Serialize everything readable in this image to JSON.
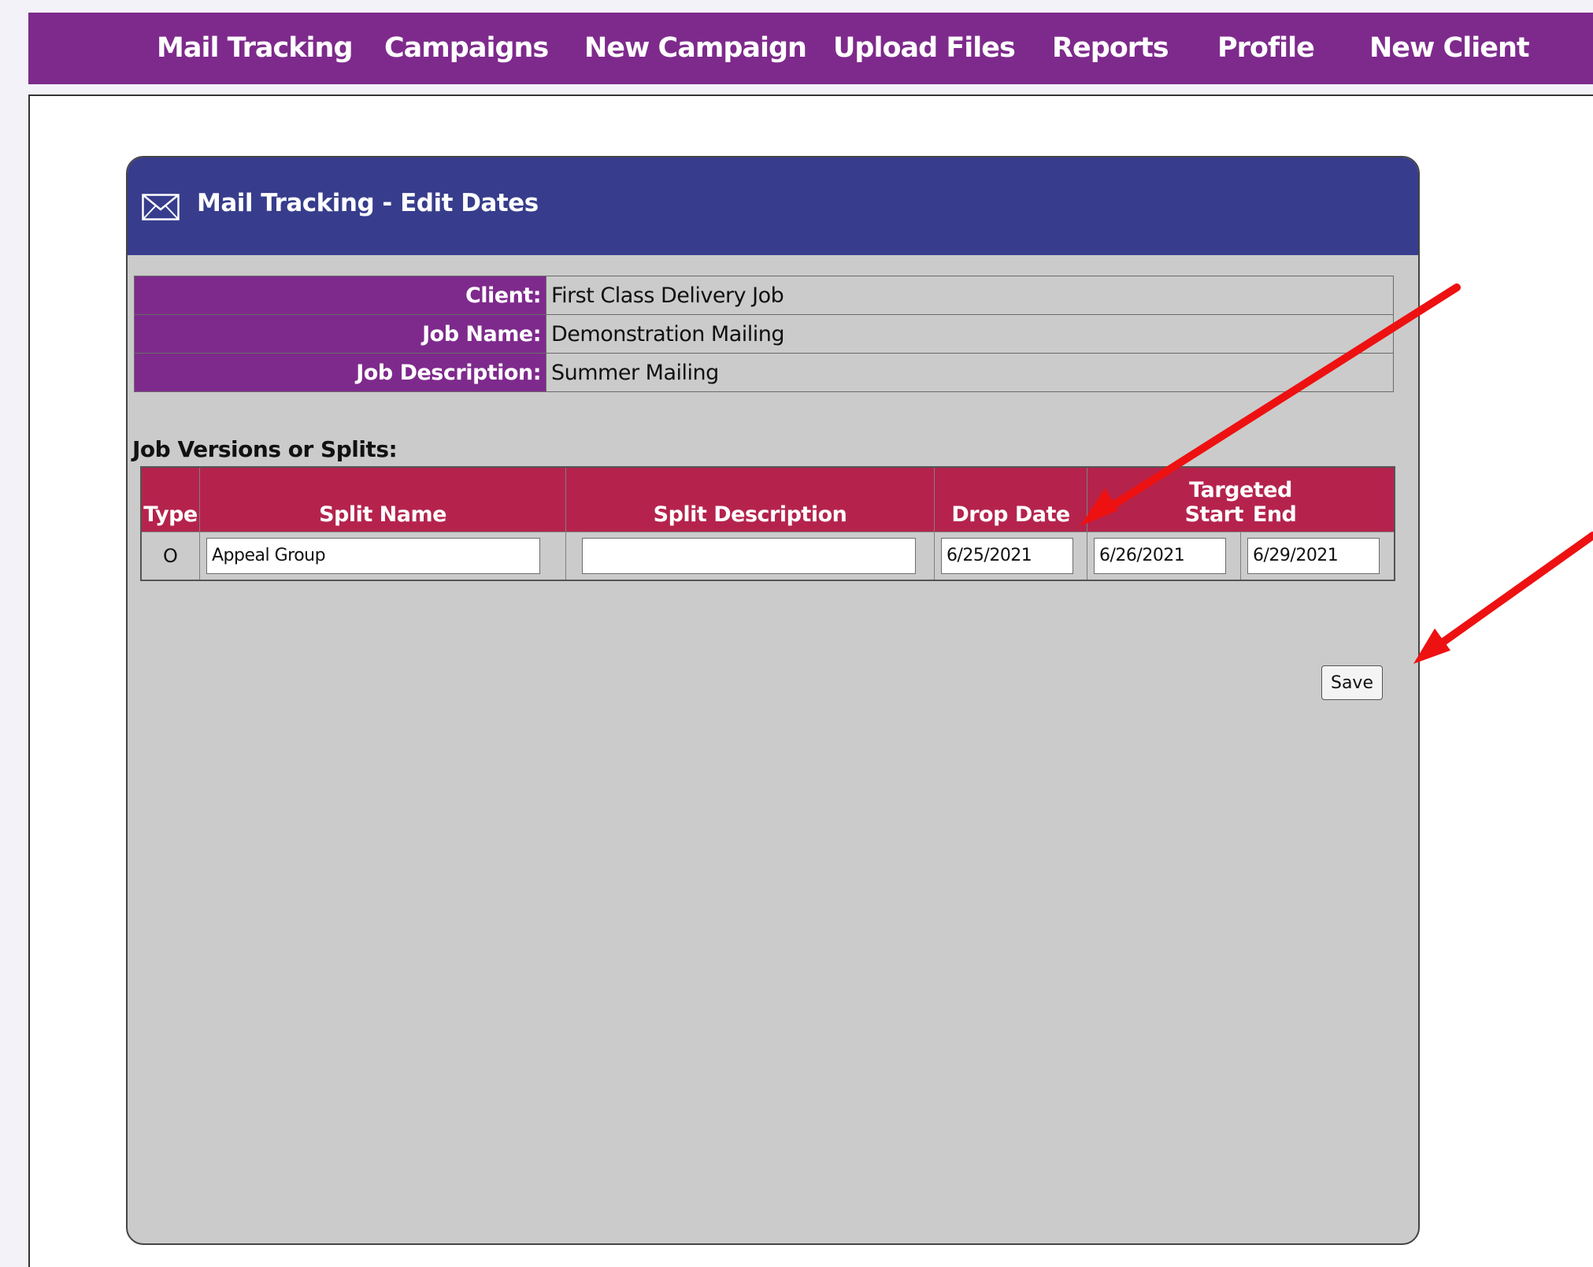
{
  "nav": {
    "items": [
      {
        "label": "Mail Tracking"
      },
      {
        "label": "Campaigns"
      },
      {
        "label": "New Campaign"
      },
      {
        "label": "Upload Files"
      },
      {
        "label": "Reports"
      },
      {
        "label": "Profile"
      },
      {
        "label": "New Client"
      }
    ],
    "bg_color": "#7e2a8c"
  },
  "panel": {
    "title": "Mail Tracking - Edit Dates",
    "header_color": "#373d8c",
    "icon": "envelope-icon"
  },
  "info": {
    "client_label": "Client:",
    "client_value": "First Class Delivery Job",
    "job_name_label": "Job Name:",
    "job_name_value": "Demonstration Mailing",
    "job_desc_label": "Job Description:",
    "job_desc_value": "Summer Mailing"
  },
  "splits": {
    "section_label": "Job Versions or Splits:",
    "headers": {
      "type": "Type",
      "split_name": "Split Name",
      "split_description": "Split Description",
      "drop_date": "Drop Date",
      "targeted": "Targeted",
      "start": "Start",
      "end": "End"
    },
    "header_color": "#b5234d",
    "rows": [
      {
        "type": "O",
        "split_name": "Appeal Group",
        "split_description": "",
        "drop_date": "6/25/2021",
        "target_start": "6/26/2021",
        "target_end": "6/29/2021"
      }
    ]
  },
  "actions": {
    "save_label": "Save"
  },
  "annotations": {
    "arrow_color": "#ee1111",
    "arrows": [
      {
        "points_to": "drop-date-header"
      },
      {
        "points_to": "save-button"
      }
    ]
  }
}
